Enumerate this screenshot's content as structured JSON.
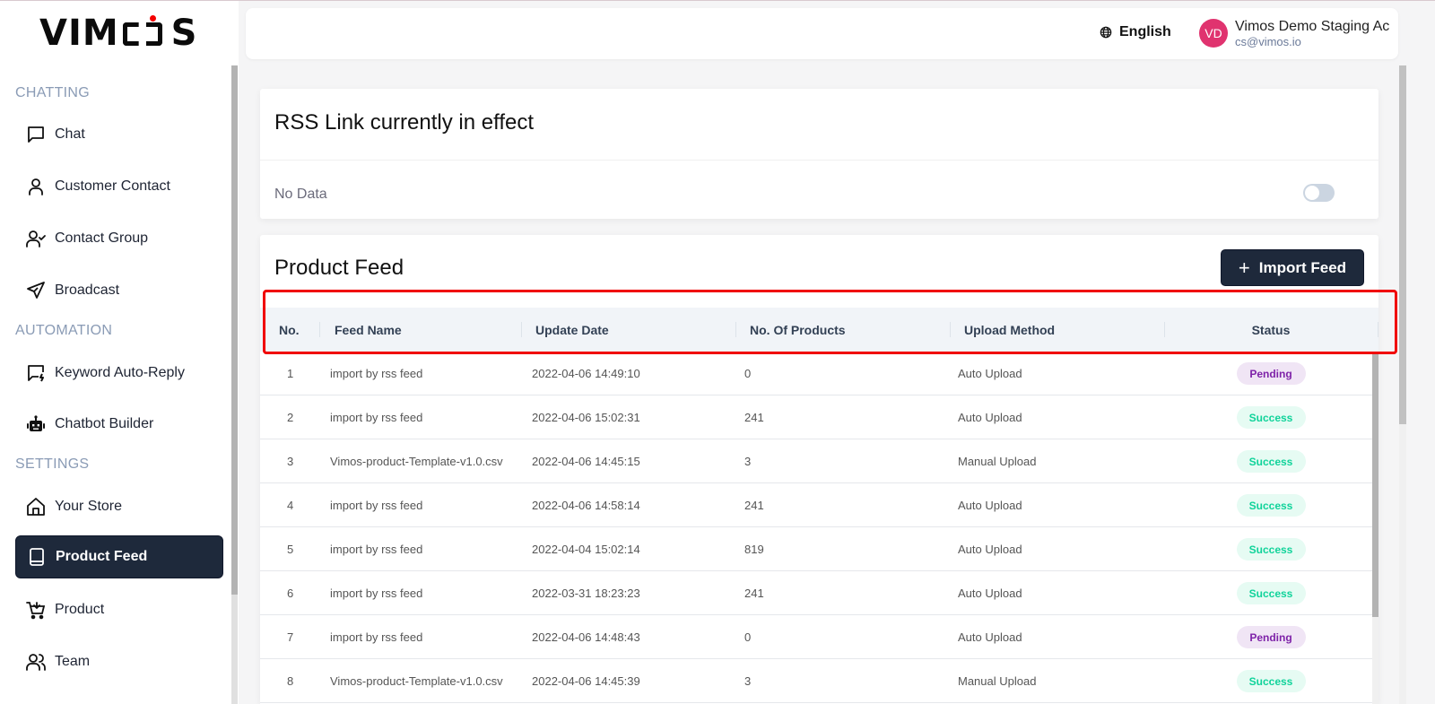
{
  "app": {
    "logo_text_left": "VIM",
    "logo_text_right": "S",
    "accent_color": "#1e293b",
    "logo_dot_color": "#f40000"
  },
  "sidebar": {
    "sections": [
      {
        "label": "CHATTING"
      },
      {
        "label": "AUTOMATION"
      },
      {
        "label": "SETTINGS"
      }
    ],
    "items": [
      {
        "label": "Chat",
        "icon": "chat-bubble-icon",
        "section": "CHATTING",
        "active": false
      },
      {
        "label": "Customer Contact",
        "icon": "user-icon",
        "section": "CHATTING",
        "active": false
      },
      {
        "label": "Contact Group",
        "icon": "user-check-icon",
        "section": "CHATTING",
        "active": false
      },
      {
        "label": "Broadcast",
        "icon": "send-icon",
        "section": "CHATTING",
        "active": false
      },
      {
        "label": "Keyword Auto-Reply",
        "icon": "message-bolt-icon",
        "section": "AUTOMATION",
        "active": false
      },
      {
        "label": "Chatbot Builder",
        "icon": "robot-icon",
        "section": "AUTOMATION",
        "active": false
      },
      {
        "label": "Your Store",
        "icon": "home-icon",
        "section": "SETTINGS",
        "active": false
      },
      {
        "label": "Product Feed",
        "icon": "book-icon",
        "section": "SETTINGS",
        "active": true
      },
      {
        "label": "Product",
        "icon": "cart-icon",
        "section": "SETTINGS",
        "active": false
      },
      {
        "label": "Team",
        "icon": "users-icon",
        "section": "SETTINGS",
        "active": false
      }
    ]
  },
  "header": {
    "language": "English",
    "avatar_initials": "VD",
    "avatar_color": "#e0336f",
    "account_name": "Vimos Demo Staging Ac",
    "account_email": "cs@vimos.io"
  },
  "rss": {
    "title": "RSS Link currently in effect",
    "empty_text": "No Data",
    "toggle_on": false
  },
  "feed": {
    "title": "Product Feed",
    "import_button": "Import Feed",
    "import_icon": "+",
    "columns": [
      "No.",
      "Feed Name",
      "Update Date",
      "No. Of Products",
      "Upload Method",
      "Status"
    ],
    "rows": [
      {
        "no": "1",
        "name": "import by rss feed",
        "date": "2022-04-06 14:49:10",
        "products": "0",
        "method": "Auto Upload",
        "status": "Pending"
      },
      {
        "no": "2",
        "name": "import by rss feed",
        "date": "2022-04-06 15:02:31",
        "products": "241",
        "method": "Auto Upload",
        "status": "Success"
      },
      {
        "no": "3",
        "name": "Vimos-product-Template-v1.0.csv",
        "date": "2022-04-06 14:45:15",
        "products": "3",
        "method": "Manual Upload",
        "status": "Success"
      },
      {
        "no": "4",
        "name": "import by rss feed",
        "date": "2022-04-06 14:58:14",
        "products": "241",
        "method": "Auto Upload",
        "status": "Success"
      },
      {
        "no": "5",
        "name": "import by rss feed",
        "date": "2022-04-04 15:02:14",
        "products": "819",
        "method": "Auto Upload",
        "status": "Success"
      },
      {
        "no": "6",
        "name": "import by rss feed",
        "date": "2022-03-31 18:23:23",
        "products": "241",
        "method": "Auto Upload",
        "status": "Success"
      },
      {
        "no": "7",
        "name": "import by rss feed",
        "date": "2022-04-06 14:48:43",
        "products": "0",
        "method": "Auto Upload",
        "status": "Pending"
      },
      {
        "no": "8",
        "name": "Vimos-product-Template-v1.0.csv",
        "date": "2022-04-06 14:45:39",
        "products": "3",
        "method": "Manual Upload",
        "status": "Success"
      }
    ],
    "status_colors": {
      "Pending": {
        "bg": "#f0e5f5",
        "fg": "#7e22a8"
      },
      "Success": {
        "bg": "#e6fbf3",
        "fg": "#10d39a"
      }
    }
  },
  "annotation": {
    "highlight_color": "#f00000",
    "target": "table-header"
  }
}
